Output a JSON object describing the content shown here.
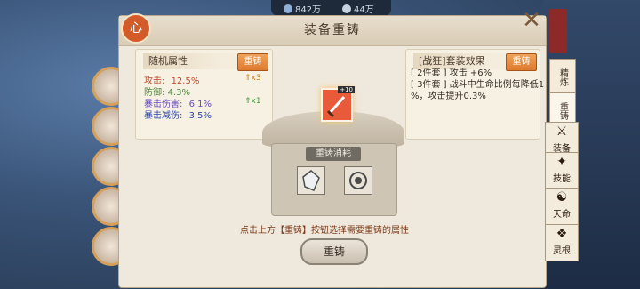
{
  "topbar": {
    "resource1": "842万",
    "resource2": "44万"
  },
  "window": {
    "title": "装备重铸",
    "logo": "心",
    "close_label": "✕"
  },
  "random_attr": {
    "header": "随机属性",
    "recast_button": "重铸",
    "stats": [
      {
        "label": "攻击:",
        "value": "12.5%"
      },
      {
        "label": "防御:",
        "value": "4.3%"
      },
      {
        "label": "暴击伤害:",
        "value": "6.1%"
      },
      {
        "label": "暴击减伤:",
        "value": "3.5%"
      }
    ],
    "marks": [
      {
        "label": "x3"
      },
      {
        "label": "x1"
      }
    ]
  },
  "set_effect": {
    "header": "[战狂]套装效果",
    "recast_button": "重铸",
    "lines": [
      "[ 2件套 ] 攻击 +6%",
      "[ 3件套 ] 战斗中生命比例每降低1",
      "%，攻击提升0.3%"
    ]
  },
  "item": {
    "level": "+10"
  },
  "altar": {
    "label": "重铸消耗"
  },
  "hint_text": "点击上方【重铸】按钮选择需要重铸的属性",
  "recast_main_button": "重铸",
  "tabs": [
    {
      "label": "精炼"
    },
    {
      "label": "重铸"
    },
    {
      "label": "装备"
    },
    {
      "label": "技能"
    },
    {
      "label": "天命"
    },
    {
      "label": "灵根"
    }
  ]
}
